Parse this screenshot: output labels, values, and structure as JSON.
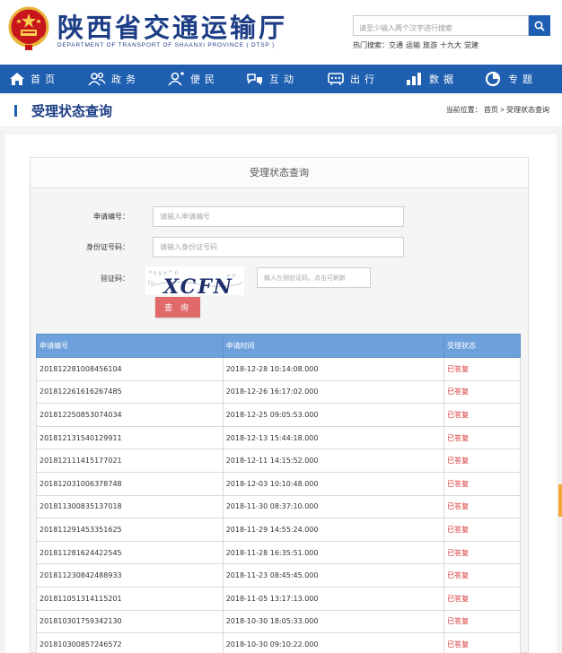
{
  "header": {
    "site_title": "陕西省交通运输厅",
    "site_subtitle": "DEPARTMENT OF TRANSPORT OF SHAANXI PROVINCE ( DTSP )",
    "search_placeholder": "请至少输入两个汉字进行搜索",
    "hot_label": "热门搜索：",
    "hot_terms": [
      "交通",
      "运输",
      "旅游",
      "十九大",
      "党建"
    ]
  },
  "nav": {
    "items": [
      {
        "label": "首页",
        "icon": "home-icon"
      },
      {
        "label": "政务",
        "icon": "people-icon"
      },
      {
        "label": "便民",
        "icon": "service-icon"
      },
      {
        "label": "互动",
        "icon": "interact-icon"
      },
      {
        "label": "出行",
        "icon": "travel-icon"
      },
      {
        "label": "数据",
        "icon": "data-icon"
      },
      {
        "label": "专题",
        "icon": "topic-icon"
      }
    ]
  },
  "title_bar": {
    "page_title": "受理状态查询",
    "breadcrumb_label": "当前位置：",
    "breadcrumb_home": "首页",
    "breadcrumb_sep": ">",
    "breadcrumb_current": "受理状态查询"
  },
  "form": {
    "panel_title": "受理状态查询",
    "app_no_label": "申请编号：",
    "app_no_placeholder": "请输入申请编号",
    "id_label": "身份证号码：",
    "id_placeholder": "请输入身份证号码",
    "captcha_label": "验证码：",
    "captcha_text": "XCFN",
    "captcha_placeholder": "输入左侧验证码，点击可刷新",
    "submit_label": "查 询"
  },
  "table": {
    "headers": [
      "申请编号",
      "申请时间",
      "受理状态"
    ],
    "rows": [
      [
        "201812281008456104",
        "2018-12-28 10:14:08.000",
        "已答复"
      ],
      [
        "201812261616267485",
        "2018-12-26 16:17:02.000",
        "已答复"
      ],
      [
        "201812250853074034",
        "2018-12-25 09:05:53.000",
        "已答复"
      ],
      [
        "201812131540129911",
        "2018-12-13 15:44:18.000",
        "已答复"
      ],
      [
        "201812111415177021",
        "2018-12-11 14:15:52.000",
        "已答复"
      ],
      [
        "201812031006378748",
        "2018-12-03 10:10:48.000",
        "已答复"
      ],
      [
        "201811300835137018",
        "2018-11-30 08:37:10.000",
        "已答复"
      ],
      [
        "201811291453351625",
        "2018-11-29 14:55:24.000",
        "已答复"
      ],
      [
        "201811281624422545",
        "2018-11-28 16:35:51.000",
        "已答复"
      ],
      [
        "201811230842488933",
        "2018-11-23 08:45:45.000",
        "已答复"
      ],
      [
        "201811051314115201",
        "2018-11-05 13:17:13.000",
        "已答复"
      ],
      [
        "201810301759342130",
        "2018-10-30 18:05:33.000",
        "已答复"
      ],
      [
        "201810300857246572",
        "2018-10-30 09:10:22.000",
        "已答复"
      ]
    ]
  },
  "colors": {
    "brand_blue": "#1e5fb0",
    "title_blue": "#1d3e86",
    "table_header": "#6ea1dc",
    "status_red": "#d83434",
    "button_red": "#e06a6a"
  }
}
